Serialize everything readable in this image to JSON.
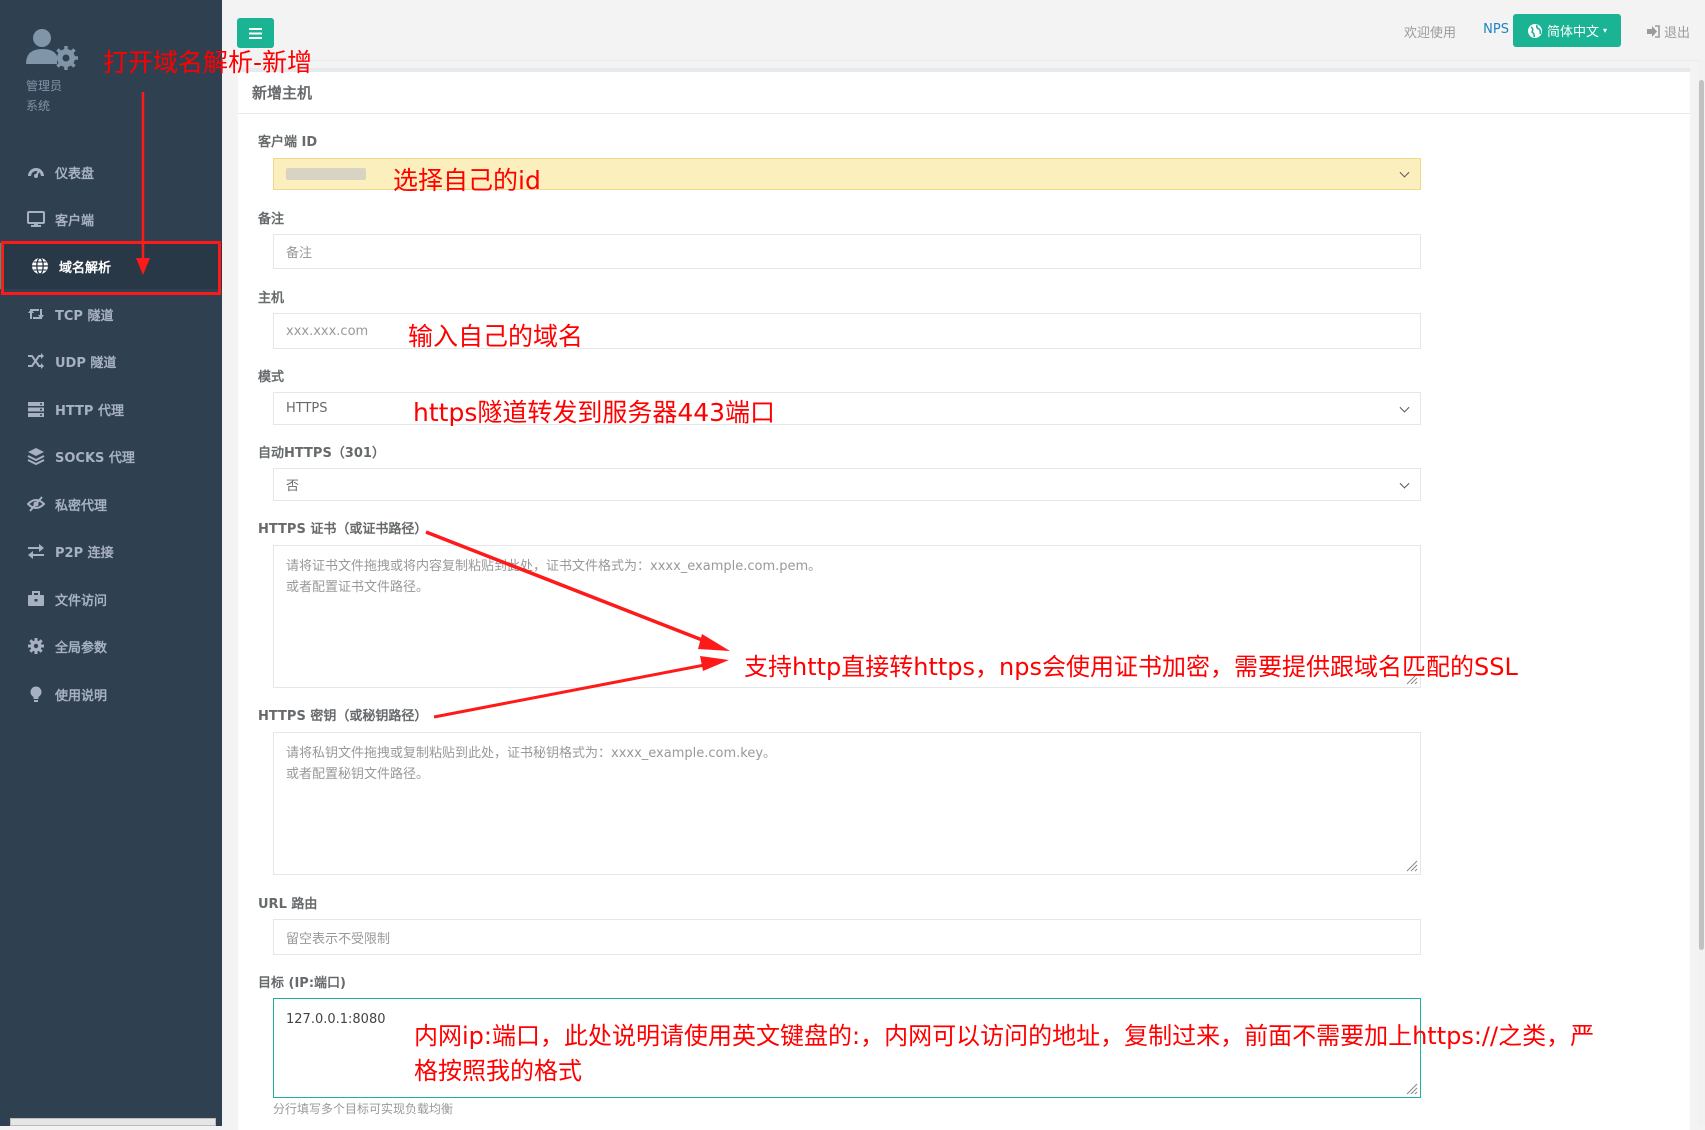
{
  "profile": {
    "role": "管理员",
    "system": "系统"
  },
  "sidebar": {
    "items": [
      {
        "label": "仪表盘",
        "icon": "dashboard-icon"
      },
      {
        "label": "客户端",
        "icon": "monitor-icon"
      },
      {
        "label": "域名解析",
        "icon": "globe-icon",
        "active": true
      },
      {
        "label": "TCP 隧道",
        "icon": "retweet-icon"
      },
      {
        "label": "UDP 隧道",
        "icon": "shuffle-icon"
      },
      {
        "label": "HTTP 代理",
        "icon": "server-icon"
      },
      {
        "label": "SOCKS 代理",
        "icon": "layers-icon"
      },
      {
        "label": "私密代理",
        "icon": "eye-slash-icon"
      },
      {
        "label": "P2P 连接",
        "icon": "exchange-icon"
      },
      {
        "label": "文件访问",
        "icon": "briefcase-icon"
      },
      {
        "label": "全局参数",
        "icon": "gear-icon"
      },
      {
        "label": "使用说明",
        "icon": "lightbulb-icon"
      }
    ]
  },
  "topbar": {
    "welcome": "欢迎使用",
    "brand": "NPS",
    "language": "简体中文",
    "logout": "退出"
  },
  "form": {
    "title": "新增主机",
    "client_id": {
      "label": "客户端 ID",
      "value": ""
    },
    "remark": {
      "label": "备注",
      "placeholder": "备注"
    },
    "host": {
      "label": "主机",
      "placeholder": "xxx.xxx.com"
    },
    "mode": {
      "label": "模式",
      "value": "HTTPS"
    },
    "auto_https": {
      "label": "自动HTTPS（301）",
      "value": "否"
    },
    "cert": {
      "label": "HTTPS 证书（或证书路径）",
      "placeholder": "请将证书文件拖拽或将内容复制粘贴到此处，证书文件格式为：xxxx_example.com.pem。\n或者配置证书文件路径。"
    },
    "key": {
      "label": "HTTPS 密钥（或秘钥路径）",
      "placeholder": "请将私钥文件拖拽或复制粘贴到此处，证书秘钥格式为：xxxx_example.com.key。\n或者配置秘钥文件路径。"
    },
    "url_route": {
      "label": "URL 路由",
      "placeholder": "留空表示不受限制"
    },
    "target": {
      "label": "目标 (IP:端口)",
      "value": "127.0.0.1:8080",
      "help": "分行填写多个目标可实现负载均衡"
    }
  },
  "annotations": {
    "open": "打开域名解析-新增",
    "select_id": "选择自己的id",
    "domain": "输入自己的域名",
    "https": "https隧道转发到服务器443端口",
    "ssl": "支持http直接转https，nps会使用证书加密，需要提供跟域名匹配的SSL",
    "target_line1": "内网ip:端口，此处说明请使用英文键盘的:，内网可以访问的地址，复制过来，前面不需要加上https://之类，严",
    "target_line2": "格按照我的格式"
  },
  "colors": {
    "sidebar": "#2f4050",
    "accent": "#1ab394",
    "annotation": "#ff0000",
    "highlight": "#fcefbe"
  }
}
